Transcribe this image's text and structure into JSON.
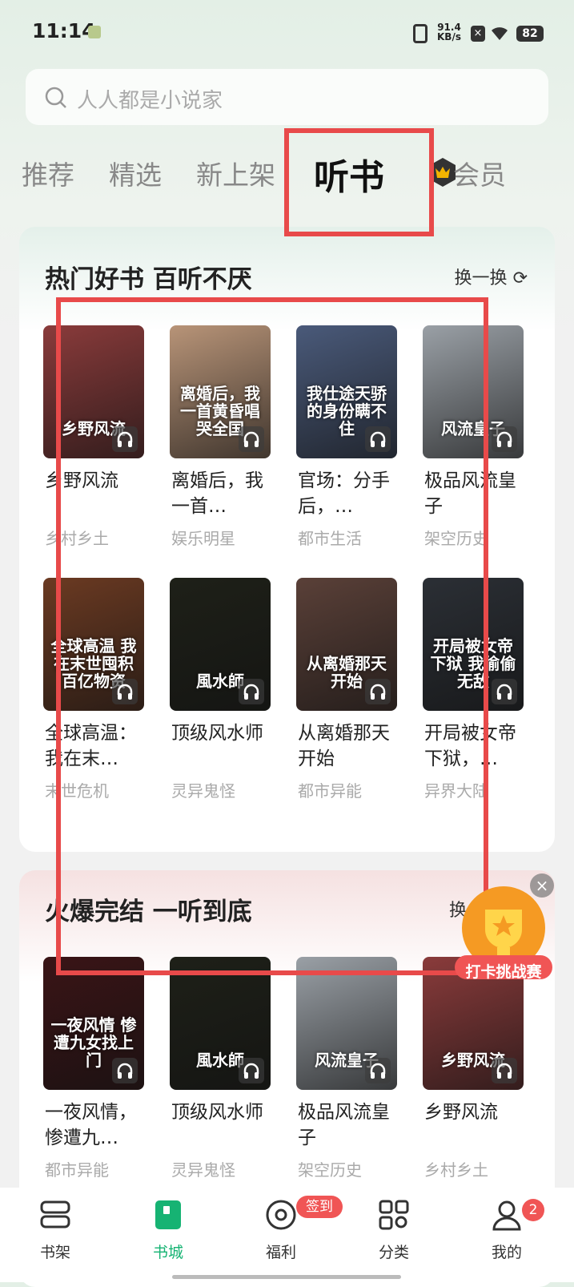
{
  "status_bar": {
    "time": "11:14",
    "speed_value": "91.4",
    "speed_unit": "KB/s",
    "battery": "82"
  },
  "search": {
    "placeholder": "人人都是小说家"
  },
  "tabs": [
    {
      "label": "推荐"
    },
    {
      "label": "精选"
    },
    {
      "label": "新上架"
    },
    {
      "label": "听书",
      "active": true
    },
    {
      "label": "会员"
    }
  ],
  "sections": [
    {
      "title": "热门好书 百听不厌",
      "action": "换一换",
      "books": [
        {
          "title": "乡野风流",
          "genre": "乡村乡土",
          "cover_text": "乡野风流",
          "cover_color": "#8a3b3b"
        },
        {
          "title": "离婚后，我一首…",
          "genre": "娱乐明星",
          "cover_text": "离婚后，我一首黄昏唱哭全国",
          "cover_color": "#b89478"
        },
        {
          "title": "官场：分手后，…",
          "genre": "都市生活",
          "cover_text": "我仕途天骄的身份瞒不住",
          "cover_color": "#4a5a7a"
        },
        {
          "title": "极品风流皇子",
          "genre": "架空历史",
          "cover_text": "风流皇子",
          "cover_color": "#9aa0a6"
        },
        {
          "title": "全球高温：我在末…",
          "genre": "末世危机",
          "cover_text": "全球高温 我在末世囤积百亿物资",
          "cover_color": "#6b3a22"
        },
        {
          "title": "顶级风水师",
          "genre": "灵异鬼怪",
          "cover_text": "風水師",
          "cover_color": "#1e2018"
        },
        {
          "title": "从离婚那天开始",
          "genre": "都市异能",
          "cover_text": "从离婚那天开始",
          "cover_color": "#5a4038"
        },
        {
          "title": "开局被女帝下狱，…",
          "genre": "异界大陆",
          "cover_text": "开局被女帝下狱 我偷偷无敌",
          "cover_color": "#2b2f35"
        }
      ]
    },
    {
      "title": "火爆完结 一听到底",
      "action": "换",
      "books": [
        {
          "title": "一夜风情，惨遭九…",
          "genre": "都市异能",
          "cover_text": "一夜风情 惨遭九女找上门",
          "cover_color": "#3a1416"
        },
        {
          "title": "顶级风水师",
          "genre": "灵异鬼怪",
          "cover_text": "風水師",
          "cover_color": "#1e2018"
        },
        {
          "title": "极品风流皇子",
          "genre": "架空历史",
          "cover_text": "风流皇子",
          "cover_color": "#9aa0a6"
        },
        {
          "title": "乡野风流",
          "genre": "乡村乡土",
          "cover_text": "乡野风流",
          "cover_color": "#8a3b3b"
        }
      ]
    }
  ],
  "floating_badge": {
    "label": "打卡挑战赛"
  },
  "bottom_nav": [
    {
      "label": "书架"
    },
    {
      "label": "书城",
      "active": true
    },
    {
      "label": "福利",
      "badge": "签到"
    },
    {
      "label": "分类"
    },
    {
      "label": "我的",
      "badge": "2"
    }
  ],
  "colors": {
    "accent": "#16b373",
    "highlight": "#e84a4a",
    "badge": "#f05555"
  }
}
